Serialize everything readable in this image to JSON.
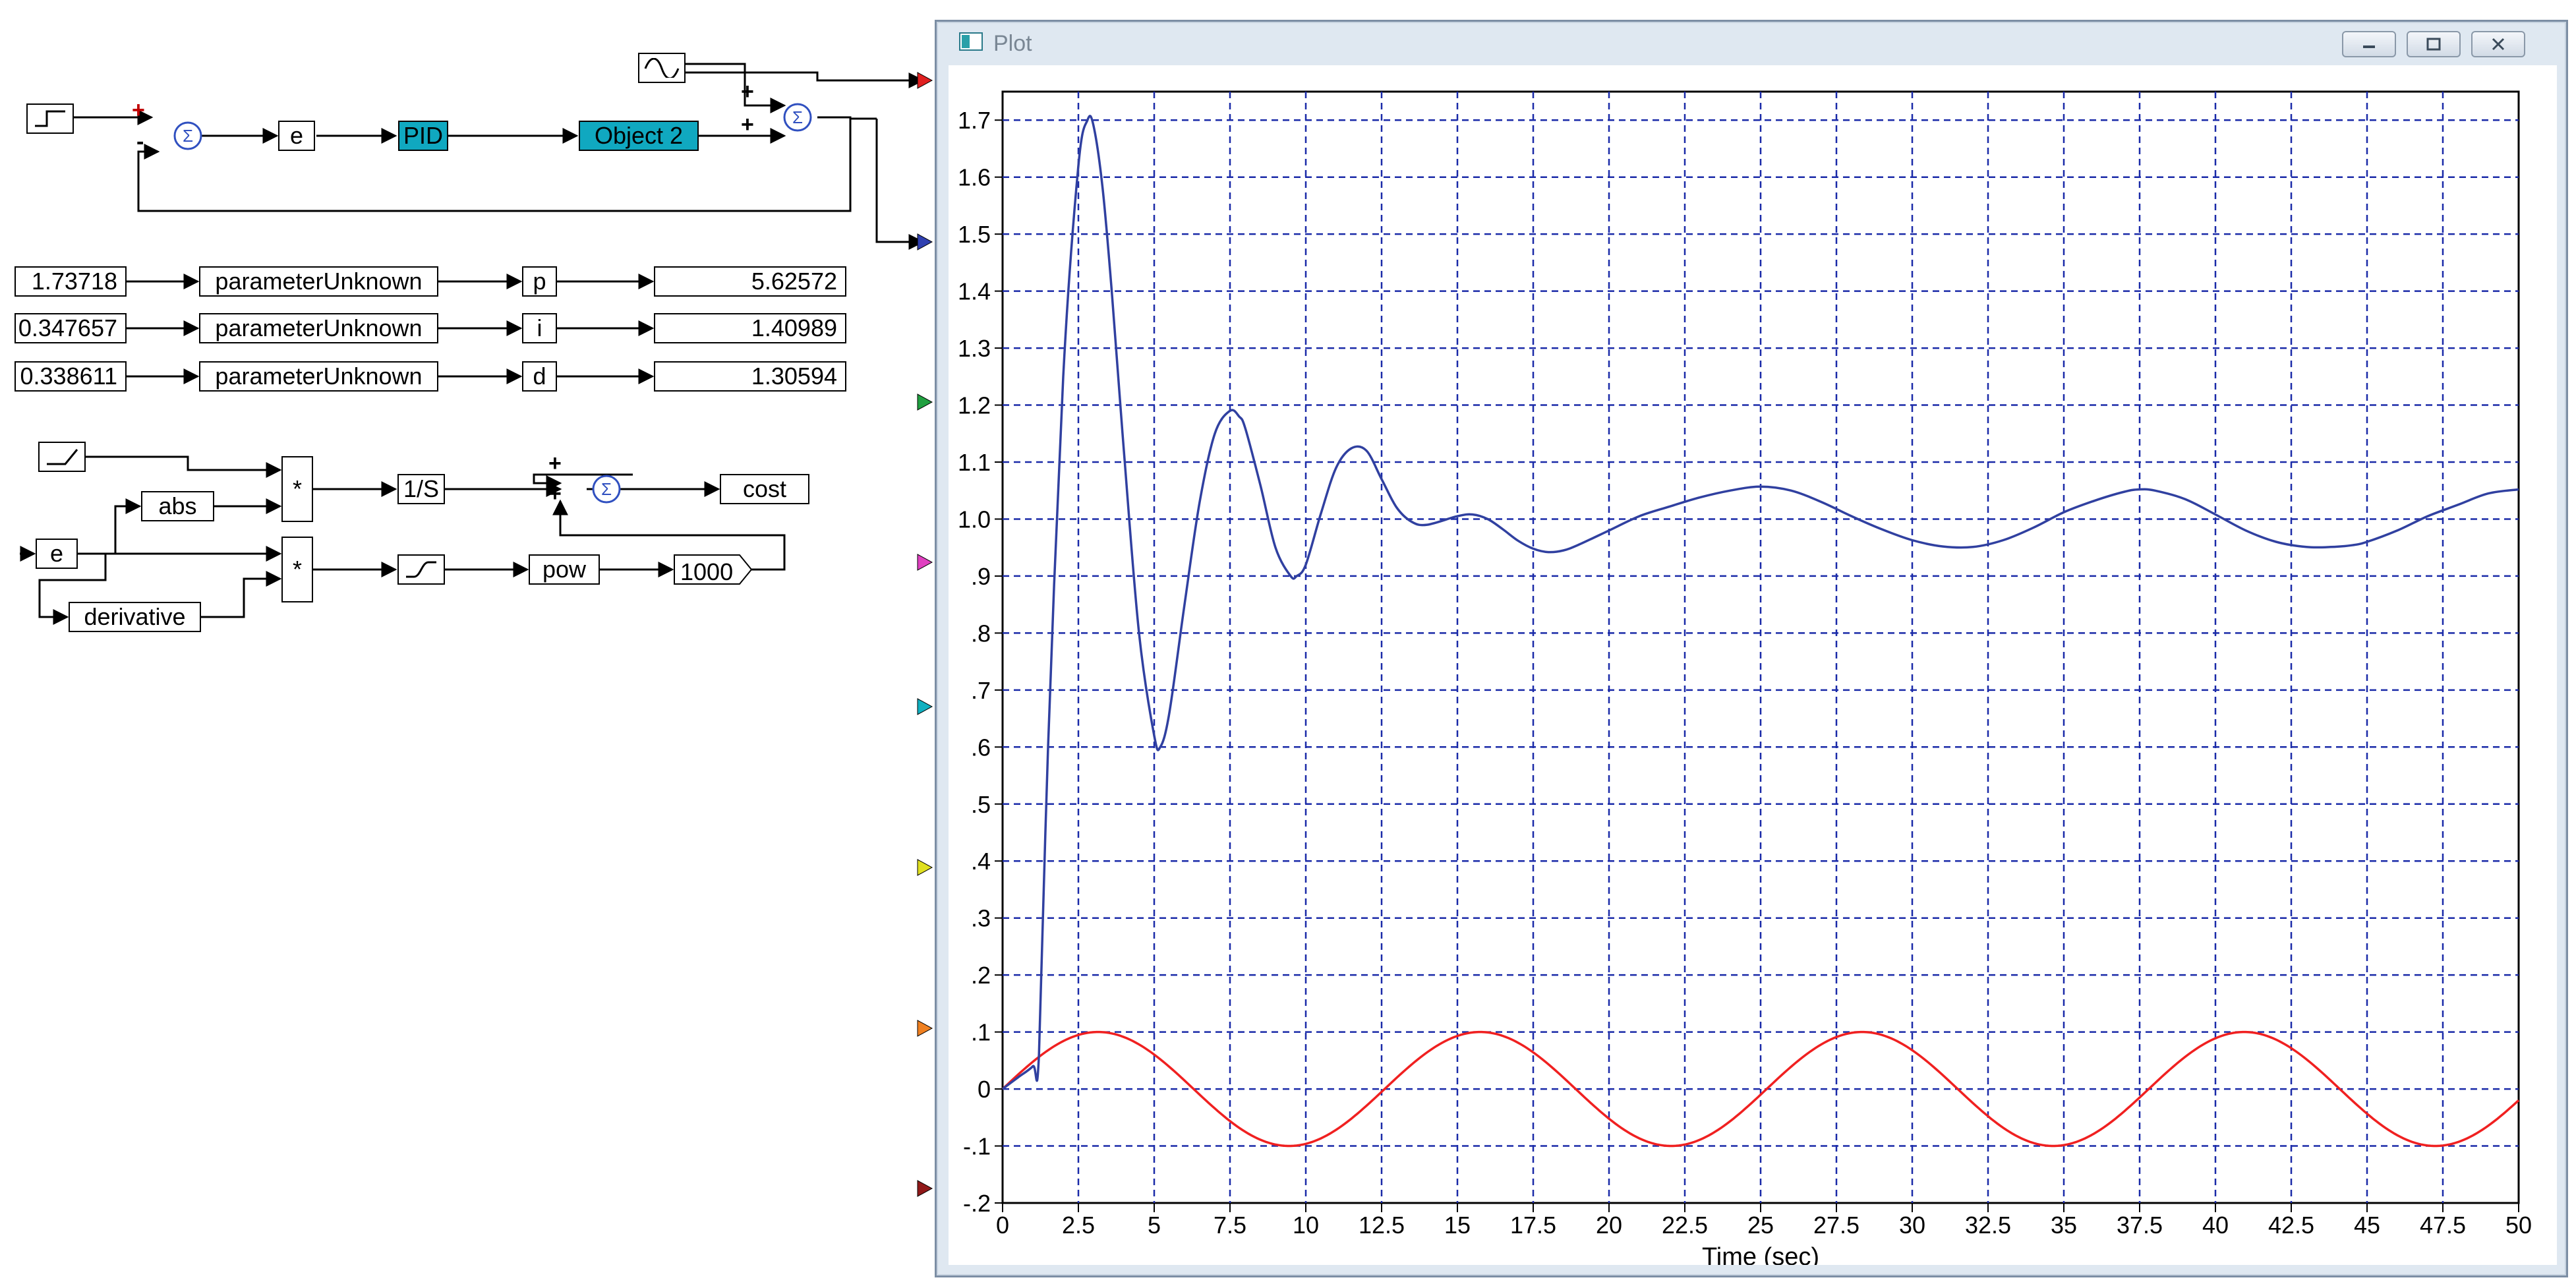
{
  "window": {
    "title": "Plot",
    "buttons": [
      "minimize",
      "maximize",
      "close"
    ]
  },
  "diagram": {
    "top_loop": {
      "sum1_signs": [
        "+",
        "-"
      ],
      "sum2_signs": [
        "+",
        "+"
      ],
      "error_label": "e",
      "pid_label": "PID",
      "object_label": "Object 2"
    },
    "parameters": [
      {
        "initial": "1.73718",
        "block": "parameterUnknown",
        "name": "p",
        "result": "5.62572"
      },
      {
        "initial": "0.347657",
        "block": "parameterUnknown",
        "name": "i",
        "result": "1.40989"
      },
      {
        "initial": "0.338611",
        "block": "parameterUnknown",
        "name": "d",
        "result": "1.30594"
      }
    ],
    "cost": {
      "abs_label": "abs",
      "mult1": "*",
      "mult2": "*",
      "integrator": "1/S",
      "cost_label": "cost",
      "e_label": "e",
      "derivative_label": "derivative",
      "pow_label": "pow",
      "gain_label": "1000",
      "sum_signs": [
        "+",
        "+"
      ]
    },
    "port_colors": [
      "#e02020",
      "#3040b0",
      "#20a040",
      "#e040c0",
      "#10b0c0",
      "#e0e020",
      "#f08020",
      "#901818"
    ]
  },
  "chart_data": {
    "type": "line",
    "title": "",
    "xlabel": "Time (sec)",
    "ylabel": "",
    "xlim": [
      0,
      50
    ],
    "ylim": [
      -0.2,
      1.75
    ],
    "grid": true,
    "x_ticks": [
      "0",
      "2.5",
      "5",
      "7.5",
      "10",
      "12.5",
      "15",
      "17.5",
      "20",
      "22.5",
      "25",
      "27.5",
      "30",
      "32.5",
      "35",
      "37.5",
      "40",
      "42.5",
      "45",
      "47.5",
      "50"
    ],
    "y_ticks": [
      "-.2",
      "-.1",
      "0",
      ".1",
      ".2",
      ".3",
      ".4",
      ".5",
      ".6",
      ".7",
      ".8",
      ".9",
      "1.0",
      "1.1",
      "1.2",
      "1.3",
      "1.4",
      "1.5",
      "1.6",
      "1.7"
    ],
    "series": [
      {
        "color": "#3040a0",
        "x": [
          0,
          0.5,
          1.0,
          1.2,
          1.5,
          2.0,
          2.5,
          2.8,
          3.0,
          3.3,
          3.6,
          4.0,
          4.5,
          5.0,
          5.2,
          5.5,
          6.0,
          6.5,
          7.0,
          7.5,
          7.8,
          8.0,
          8.5,
          9.0,
          9.5,
          9.7,
          10.0,
          10.5,
          11.0,
          11.5,
          12.0,
          12.5,
          13.0,
          13.5,
          14.0,
          15.0,
          15.5,
          16.0,
          16.5,
          17.0,
          17.5,
          18.0,
          18.5,
          19.0,
          20.0,
          21.0,
          22.0,
          23.0,
          24.0,
          25.0,
          26.0,
          27.0,
          28.0,
          29.0,
          30.0,
          31.0,
          32.0,
          33.0,
          34.0,
          35.0,
          36.0,
          37.0,
          37.5,
          38.0,
          39.0,
          40.0,
          41.0,
          42.0,
          43.0,
          43.8,
          44.5,
          45.0,
          46.0,
          47.0,
          48.0,
          49.0,
          50.0
        ],
        "y": [
          0.0,
          0.02,
          0.04,
          0.06,
          0.6,
          1.25,
          1.62,
          1.7,
          1.69,
          1.58,
          1.4,
          1.12,
          0.8,
          0.62,
          0.6,
          0.66,
          0.85,
          1.03,
          1.15,
          1.19,
          1.18,
          1.16,
          1.06,
          0.95,
          0.9,
          0.9,
          0.92,
          1.01,
          1.09,
          1.124,
          1.12,
          1.07,
          1.02,
          0.995,
          0.99,
          1.005,
          1.008,
          1.0,
          0.982,
          0.962,
          0.948,
          0.942,
          0.945,
          0.955,
          0.98,
          1.005,
          1.022,
          1.038,
          1.05,
          1.057,
          1.05,
          1.03,
          1.005,
          0.982,
          0.963,
          0.952,
          0.951,
          0.963,
          0.985,
          1.012,
          1.032,
          1.048,
          1.052,
          1.05,
          1.035,
          1.008,
          0.98,
          0.96,
          0.951,
          0.951,
          0.954,
          0.96,
          0.98,
          1.005,
          1.025,
          1.045,
          1.052
        ]
      },
      {
        "color": "#f02020",
        "expr": "0.1*sin(2*pi*t/12.6)",
        "amplitude": 0.1,
        "period": 12.6
      }
    ]
  }
}
